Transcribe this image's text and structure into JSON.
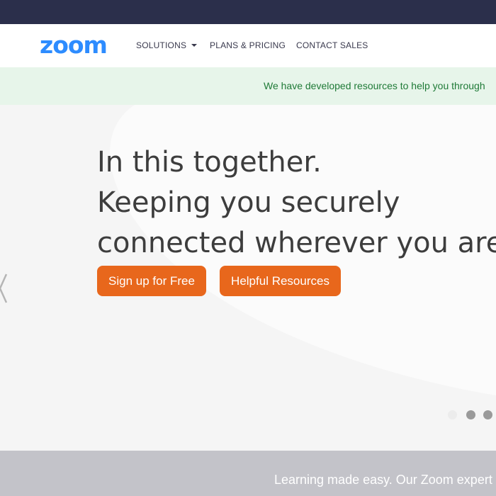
{
  "colors": {
    "topbar": "#2b2f4b",
    "brand": "#2d8cff",
    "notice_bg": "#e7f5ea",
    "notice_text": "#1f7a37",
    "cta": "#e8671c",
    "hero_bg": "#f5f5f5",
    "footer_bg": "#c3c3c9"
  },
  "header": {
    "logo": "zoom",
    "nav": {
      "solutions": "SOLUTIONS",
      "plans": "PLANS & PRICING",
      "contact": "CONTACT SALES"
    }
  },
  "notice": {
    "text": "We have developed resources to help you through"
  },
  "hero": {
    "headline": [
      "In this together.",
      "Keeping you securely",
      "connected wherever you are"
    ],
    "primary_button": "Sign up for Free",
    "secondary_button": "Helpful Resources",
    "carousel": {
      "slides": 3,
      "active_index": 0
    },
    "icons": {
      "prev": "chevron-left-icon"
    }
  },
  "footer": {
    "text": "Learning made easy. Our Zoom expert"
  }
}
